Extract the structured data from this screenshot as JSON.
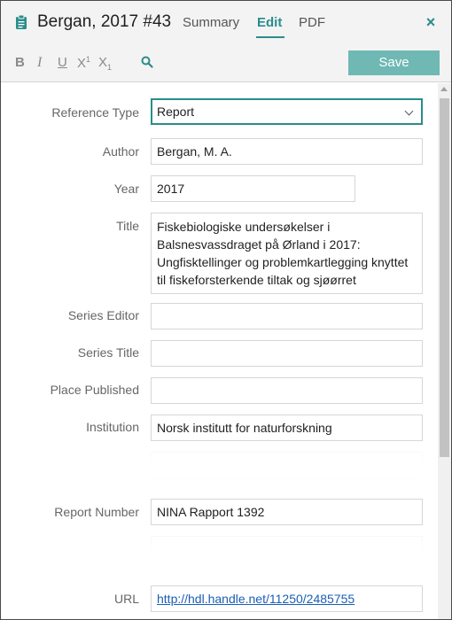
{
  "header": {
    "title": "Bergan, 2017 #43",
    "tabs": {
      "summary": "Summary",
      "edit": "Edit",
      "pdf": "PDF"
    },
    "close_icon": "×",
    "accent_color": "#2a8c8c"
  },
  "toolbar": {
    "bold": "B",
    "italic": "I",
    "underline": "U",
    "superscript": "X",
    "superscript_mark": "1",
    "subscript": "X",
    "subscript_mark": "1",
    "save_label": "Save",
    "save_color": "#6fb8b4"
  },
  "fields": {
    "reference_type": {
      "label": "Reference Type",
      "value": "Report"
    },
    "author": {
      "label": "Author",
      "value": "Bergan, M. A."
    },
    "year": {
      "label": "Year",
      "value": "2017"
    },
    "title": {
      "label": "Title",
      "value": "Fiskebiologiske undersøkelser i Balsnesvassdraget på Ørland i 2017: Ungfisktellinger og problemkartlegging knyttet til fiskeforsterkende tiltak og sjøørret"
    },
    "series_editor": {
      "label": "Series Editor",
      "value": ""
    },
    "series_title": {
      "label": "Series Title",
      "value": ""
    },
    "place_published": {
      "label": "Place Published",
      "value": ""
    },
    "institution": {
      "label": "Institution",
      "value": "Norsk institutt for naturforskning"
    },
    "report_number": {
      "label": "Report Number",
      "value": "NINA Rapport 1392"
    },
    "url": {
      "label": "URL",
      "value": "http://hdl.handle.net/11250/2485755"
    }
  }
}
